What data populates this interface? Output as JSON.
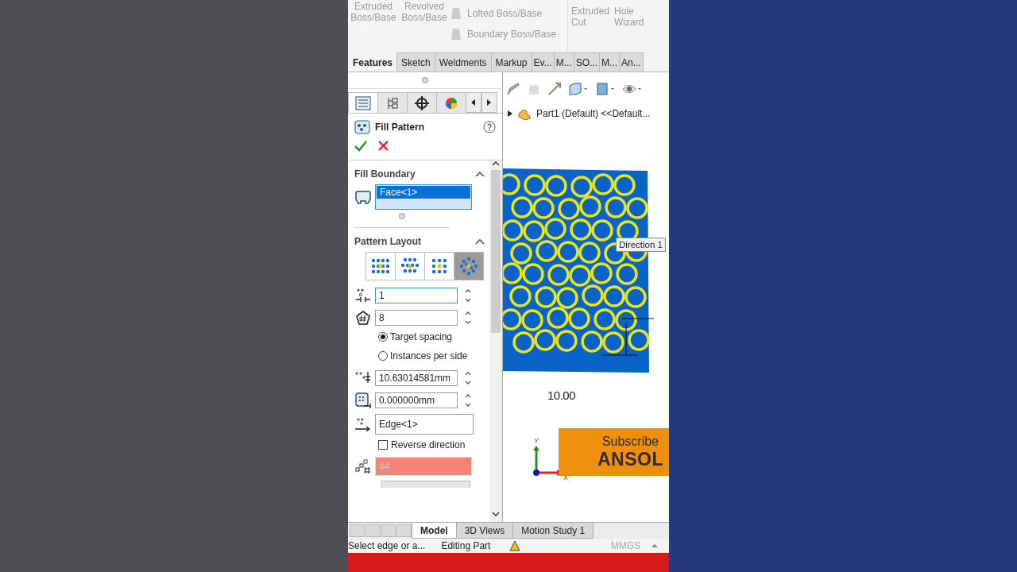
{
  "ribbon": {
    "large_commands": [
      {
        "label": "Extruded Boss/Base"
      },
      {
        "label": "Revolved Boss/Base"
      }
    ],
    "small_commands": [
      {
        "label": "Lofted Boss/Base"
      },
      {
        "label": "Boundary Boss/Base"
      }
    ],
    "cut_commands": [
      {
        "label": "Extruded Cut"
      },
      {
        "label": "Hole Wizard"
      }
    ]
  },
  "tabs": [
    {
      "label": "Features",
      "selected": true
    },
    {
      "label": "Sketch",
      "selected": false
    },
    {
      "label": "Weldments",
      "selected": false
    },
    {
      "label": "Markup",
      "selected": false
    },
    {
      "label": "Ev...",
      "selected": false
    },
    {
      "label": "M...",
      "selected": false
    },
    {
      "label": "SO...",
      "selected": false
    },
    {
      "label": "M...",
      "selected": false
    },
    {
      "label": "An...",
      "selected": false
    }
  ],
  "property_manager": {
    "icon_tabs": [
      {
        "selected": true
      },
      {
        "selected": false
      },
      {
        "selected": false
      },
      {
        "selected": false
      }
    ],
    "title": "Fill Pattern",
    "fill_boundary": {
      "title": "Fill Boundary",
      "selection": "Face<1>"
    },
    "pattern_layout": {
      "title": "Pattern Layout",
      "layouts": [
        {
          "selected": false
        },
        {
          "selected": false
        },
        {
          "selected": false
        },
        {
          "selected": true
        }
      ],
      "spacing": "1",
      "sides": "8",
      "options": [
        {
          "label": "Target spacing",
          "selected": true
        },
        {
          "label": "Instances per side",
          "selected": false
        }
      ],
      "instance_spacing": "10.63014581mm",
      "margin": "0.000000mm",
      "direction": "Edge<1>",
      "reverse": {
        "label": "Reverse direction",
        "checked": false
      },
      "instance_count": "44"
    }
  },
  "graphics": {
    "tree_item": "Part1 (Default) <<Default...",
    "callout": "Direction 1",
    "dimension": "10.00",
    "axis_y": "Y",
    "axis_x": "X"
  },
  "banner": {
    "line_1": "Subscribe",
    "line_2": "ANSOL"
  },
  "bottom_tabs": [
    {
      "label": "Model",
      "selected": true
    },
    {
      "label": "3D Views",
      "selected": false
    },
    {
      "label": "Motion Study 1",
      "selected": false
    }
  ],
  "status_bar": {
    "message": "Select edge or a...",
    "mode": "Editing Part",
    "units": "MMGS"
  }
}
